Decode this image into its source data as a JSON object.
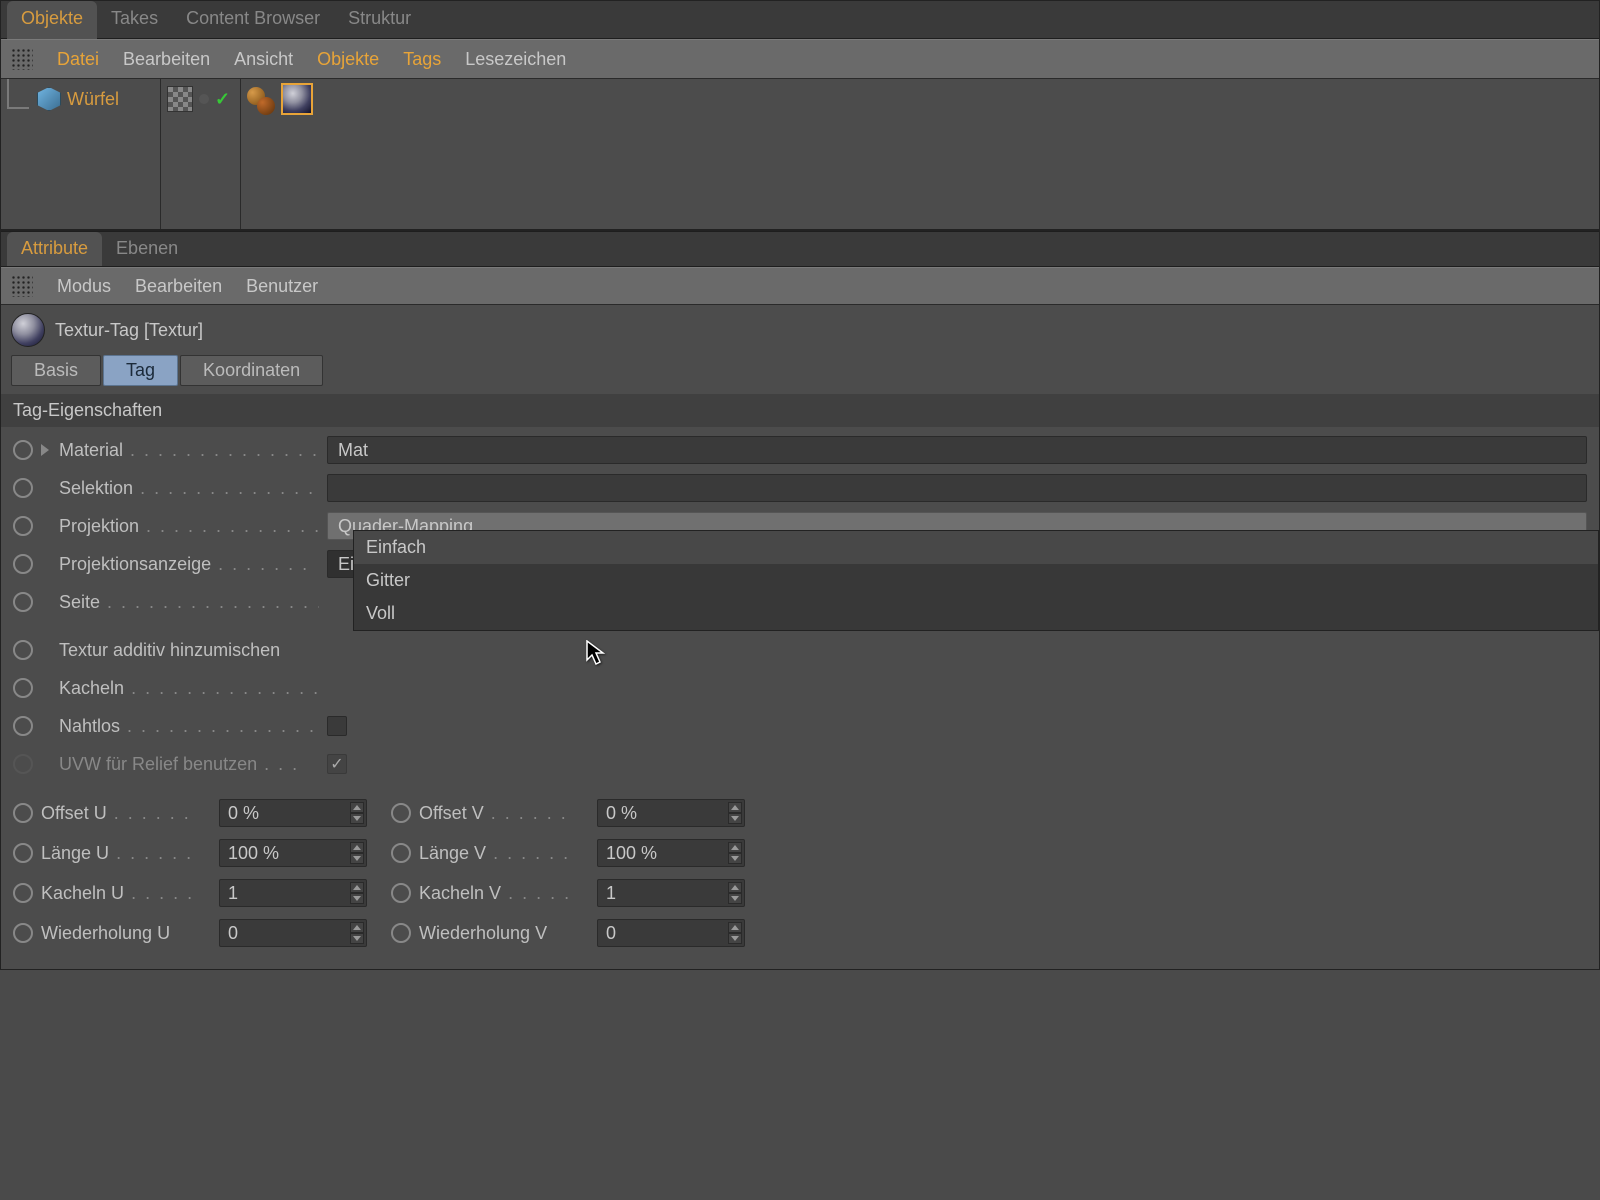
{
  "top_tabs": {
    "objekte": "Objekte",
    "takes": "Takes",
    "content_browser": "Content Browser",
    "struktur": "Struktur"
  },
  "menu1": {
    "datei": "Datei",
    "bearbeiten": "Bearbeiten",
    "ansicht": "Ansicht",
    "objekte": "Objekte",
    "tags": "Tags",
    "lesezeichen": "Lesezeichen"
  },
  "object": {
    "name": "Würfel"
  },
  "attr_tabs": {
    "attribute": "Attribute",
    "ebenen": "Ebenen"
  },
  "menu2": {
    "modus": "Modus",
    "bearbeiten": "Bearbeiten",
    "benutzer": "Benutzer"
  },
  "attr_header": "Textur-Tag [Textur]",
  "sub_tabs": {
    "basis": "Basis",
    "tag": "Tag",
    "koord": "Koordinaten"
  },
  "section": "Tag-Eigenschaften",
  "props": {
    "material_label": "Material",
    "material_value": "Mat",
    "selektion_label": "Selektion",
    "projektion_label": "Projektion",
    "projektion_value": "Quader-Mapping",
    "projanzeige_label": "Projektionsanzeige",
    "projanzeige_value": "Einfach",
    "seite_label": "Seite",
    "additiv_label": "Textur additiv hinzumischen",
    "kacheln_label": "Kacheln",
    "nahtlos_label": "Nahtlos",
    "uvw_label": "UVW für Relief benutzen"
  },
  "dropdown": {
    "opt1": "Einfach",
    "opt2": "Gitter",
    "opt3": "Voll"
  },
  "uv": {
    "offset_u_label": "Offset U",
    "offset_u_val": "0 %",
    "offset_v_label": "Offset V",
    "offset_v_val": "0 %",
    "laenge_u_label": "Länge U",
    "laenge_u_val": "100 %",
    "laenge_v_label": "Länge V",
    "laenge_v_val": "100 %",
    "kacheln_u_label": "Kacheln U",
    "kacheln_u_val": "1",
    "kacheln_v_label": "Kacheln V",
    "kacheln_v_val": "1",
    "wdh_u_label": "Wiederholung U",
    "wdh_u_val": "0",
    "wdh_v_label": "Wiederholung V",
    "wdh_v_val": "0"
  }
}
